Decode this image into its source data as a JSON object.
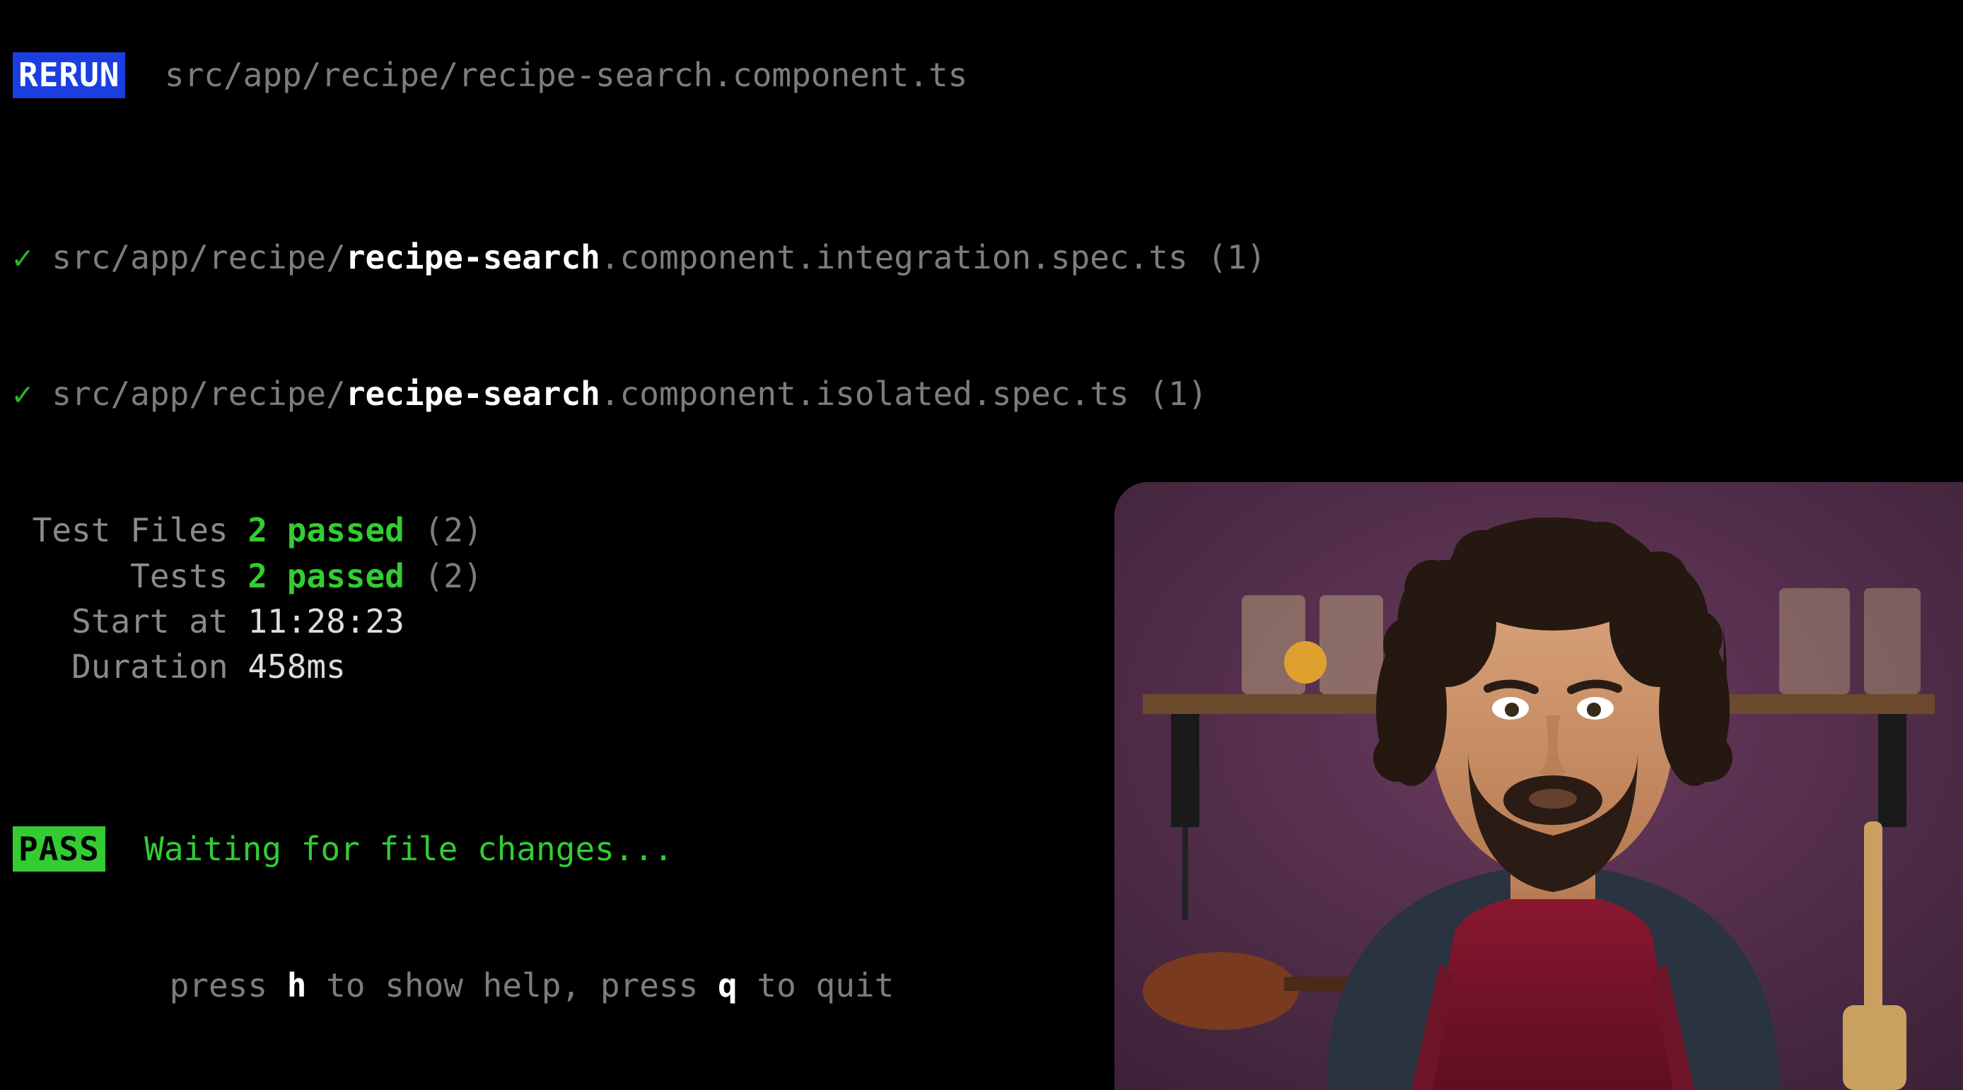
{
  "rerun": {
    "badge": "RERUN",
    "path": "src/app/recipe/recipe-search.component.ts"
  },
  "passed_files": [
    {
      "check": "✓",
      "prefix": "src/app/recipe/",
      "highlight": "recipe-search",
      "suffix": ".component.integration.spec.ts ",
      "count": "(1)"
    },
    {
      "check": "✓",
      "prefix": "src/app/recipe/",
      "highlight": "recipe-search",
      "suffix": ".component.isolated.spec.ts ",
      "count": "(1)"
    }
  ],
  "summary": {
    "test_files": {
      "label": "Test Files",
      "passed": "2 passed",
      "total": "(2)"
    },
    "tests": {
      "label": "Tests",
      "passed": "2 passed",
      "total": "(2)"
    },
    "start_at": {
      "label": "Start at",
      "value": "11:28:23"
    },
    "duration": {
      "label": "Duration",
      "value": "458ms"
    }
  },
  "footer": {
    "pass_badge": "PASS",
    "waiting": "Waiting for file changes...",
    "tip_pre": "press ",
    "tip_h": "h",
    "tip_mid": " to show help, press ",
    "tip_q": "q",
    "tip_post": " to quit"
  }
}
